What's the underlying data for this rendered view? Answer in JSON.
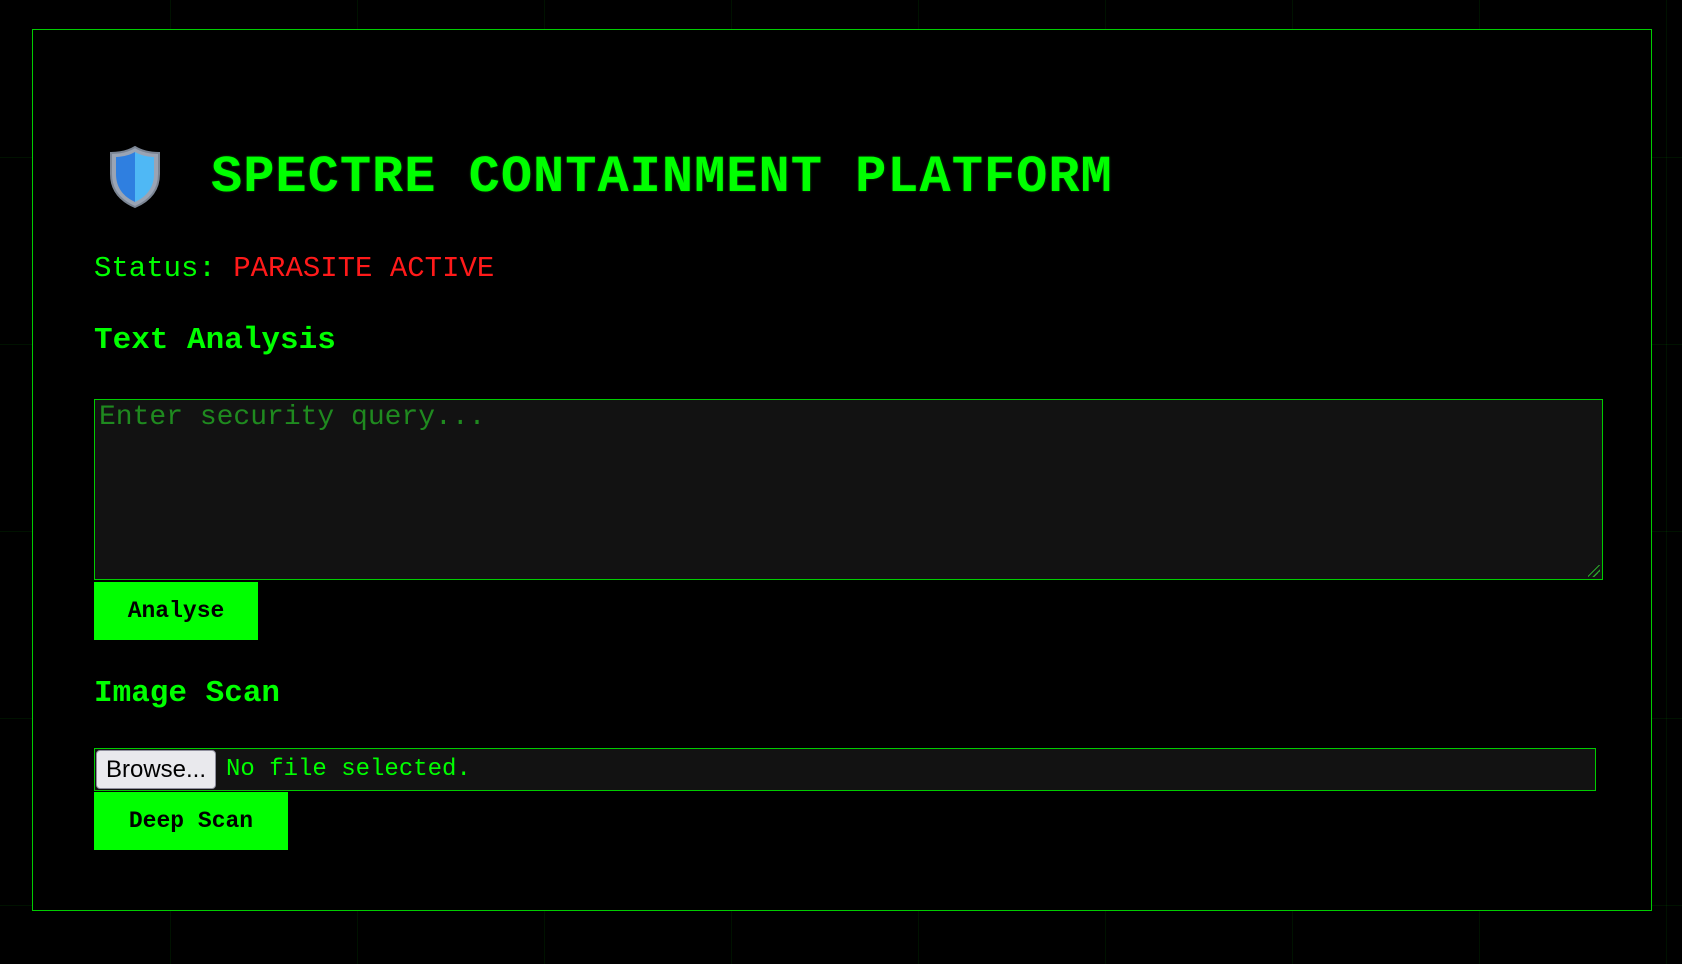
{
  "header": {
    "icon": "shield-icon",
    "title": "SPECTRE CONTAINMENT PLATFORM"
  },
  "status": {
    "label": "Status:",
    "value": "PARASITE ACTIVE",
    "value_color": "#ff1a1a"
  },
  "text_analysis": {
    "heading": "Text Analysis",
    "query_placeholder": "Enter security query...",
    "query_value": "",
    "button_label": "Analyse"
  },
  "image_scan": {
    "heading": "Image Scan",
    "browse_label": "Browse...",
    "file_status": "No file selected.",
    "button_label": "Deep Scan"
  },
  "colors": {
    "background": "#000000",
    "accent": "#00ff00",
    "alert": "#ff1a1a",
    "field_bg": "#121212"
  }
}
